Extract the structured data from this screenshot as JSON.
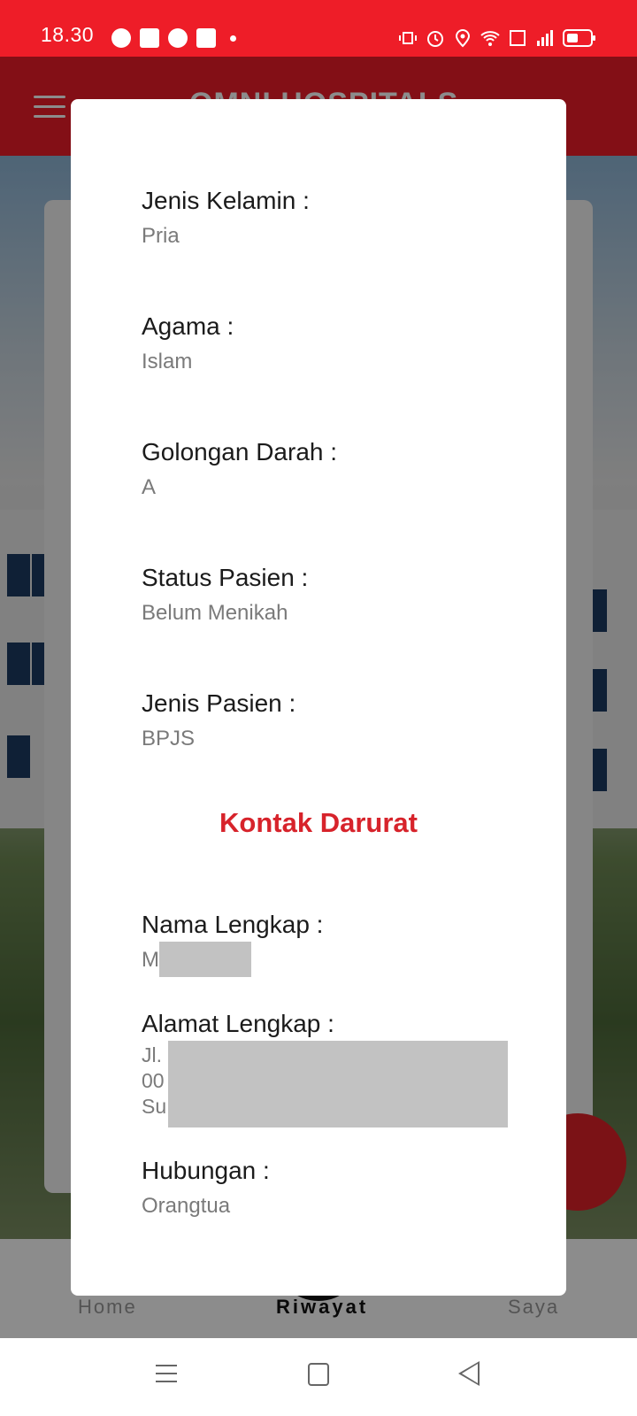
{
  "status_bar": {
    "time": "18.30",
    "left_icons": [
      "line-icon",
      "game-icon",
      "chat-icon",
      "facebook-icon",
      "dot-icon"
    ],
    "right_icons": [
      "vibrate-icon",
      "alarm-icon",
      "location-icon",
      "wifi-icon",
      "volte-icon",
      "signal-icon",
      "battery-icon"
    ]
  },
  "app_bar": {
    "title": "OMNI HOSPITALS"
  },
  "bottom_nav": {
    "items": [
      {
        "label": "Home"
      },
      {
        "label": "Riwayat"
      },
      {
        "label": "Saya"
      }
    ]
  },
  "dialog": {
    "fields": [
      {
        "label": "Jenis Kelamin :",
        "value": "Pria"
      },
      {
        "label": "Agama :",
        "value": "Islam"
      },
      {
        "label": "Golongan Darah :",
        "value": "A"
      },
      {
        "label": "Status Pasien :",
        "value": "Belum Menikah"
      },
      {
        "label": "Jenis Pasien :",
        "value": "BPJS"
      }
    ],
    "section_title": "Kontak Darurat",
    "contact": {
      "name_label": "Nama Lengkap :",
      "name_value_visible": "M",
      "address_label": "Alamat Lengkap :",
      "address_lines_visible": [
        "Jl.",
        "00",
        "Su"
      ],
      "relation_label": "Hubungan :",
      "relation_value": "Orangtua"
    }
  },
  "colors": {
    "brand_red": "#ee1d28",
    "section_title_red": "#d7232b"
  }
}
